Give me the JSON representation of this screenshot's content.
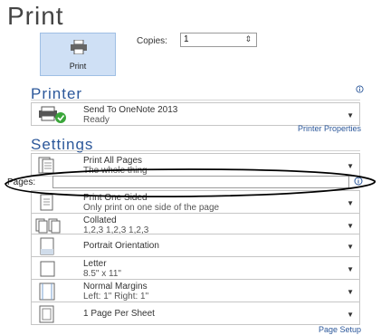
{
  "title": "Print",
  "print_button": {
    "label": "Print"
  },
  "copies": {
    "label": "Copies:",
    "value": "1"
  },
  "printer": {
    "section_title": "Printer",
    "name": "Send To OneNote 2013",
    "status": "Ready",
    "properties_link": "Printer Properties"
  },
  "settings": {
    "section_title": "Settings",
    "items": [
      {
        "line1": "Print All Pages",
        "line2": "The whole thing"
      },
      {
        "line1": "Print One Sided",
        "line2": "Only print on one side of the page"
      },
      {
        "line1": "Collated",
        "line2": "1,2,3    1,2,3    1,2,3"
      },
      {
        "line1": "Portrait Orientation"
      },
      {
        "line1": "Letter",
        "line2": "8.5\" x 11\""
      },
      {
        "line1": "Normal Margins",
        "line2": "Left:  1\"    Right:  1\""
      },
      {
        "line1": "1 Page Per Sheet"
      }
    ],
    "pages_label": "Pages:",
    "pages_value": "",
    "page_setup_link": "Page Setup"
  },
  "icons": {
    "info": "info-icon",
    "dropdown": "chevron-down-icon",
    "spinner": "spinner-icon"
  },
  "colors": {
    "accent": "#2b579a",
    "print_button_bg": "#cfe0f5",
    "highlight_oval": "#000000"
  }
}
